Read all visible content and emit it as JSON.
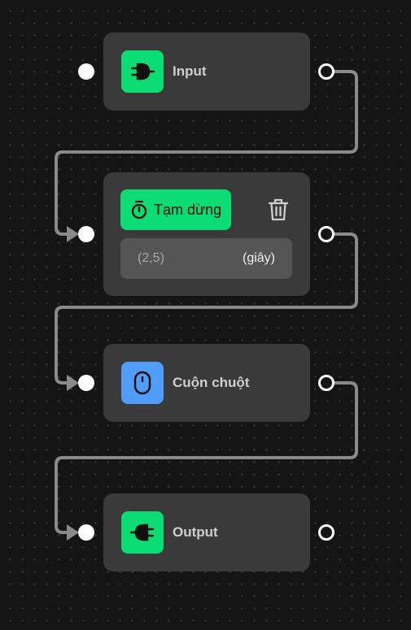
{
  "nodes": {
    "input": {
      "title": "Input",
      "icon": "logic-gate-input-icon"
    },
    "pause": {
      "action_label": "Tạm dừng",
      "action_icon": "stopwatch-icon",
      "delete_icon": "trash-icon",
      "duration_value": "(2,5)",
      "duration_unit": "(giây)"
    },
    "scroll": {
      "title": "Cuộn chuột",
      "icon": "mouse-icon"
    },
    "output": {
      "title": "Output",
      "icon": "logic-gate-output-icon"
    }
  },
  "colors": {
    "background": "#151515",
    "node": "#3a3a3a",
    "green_accent": "#0bdc73",
    "blue_accent": "#4f9cf9",
    "wire": "#8a8a8a",
    "field": "#555555"
  }
}
